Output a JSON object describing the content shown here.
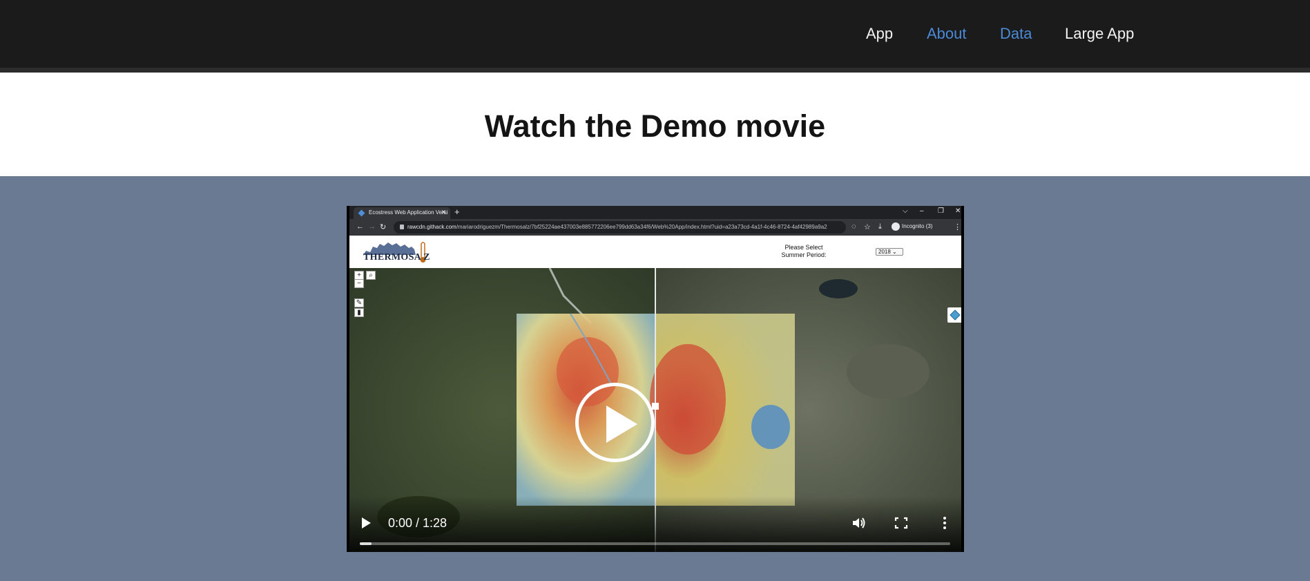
{
  "nav": {
    "items": [
      {
        "label": "App",
        "color": "#f2f2f2"
      },
      {
        "label": "About",
        "color": "#4a8ad8"
      },
      {
        "label": "Data",
        "color": "#4a8ad8"
      },
      {
        "label": "Large App",
        "color": "#f2f2f2"
      }
    ]
  },
  "hero": {
    "title": "Watch the Demo movie"
  },
  "video": {
    "browser": {
      "tab_title": "Ecostress Web Application Versi",
      "tab_close": "✕",
      "new_tab": "+",
      "window_controls": [
        "⌵",
        "–",
        "❐",
        "✕"
      ],
      "url_host": "rawcdn.githack.com",
      "url_path": "/mariarodriguezm/Thermosalz/7bf25224ae437003e885772206ee799dd63a34f6/Web%20App/index.html?uid=a23a73cd-4a1f-4c46-8724-4af42989a9a2",
      "profile_label": "Incognito (3)"
    },
    "app": {
      "logo_text": "THERMOSA Z",
      "select_label": "Please Select Summer Period:",
      "select_value": "2018 ⌄",
      "zoom_in": "+",
      "zoom_out": "−",
      "search_icon": "search-icon",
      "layers_icon": "layers-icon"
    },
    "controls": {
      "time": "0:00 / 1:28",
      "progress_fraction": 0.02
    }
  }
}
